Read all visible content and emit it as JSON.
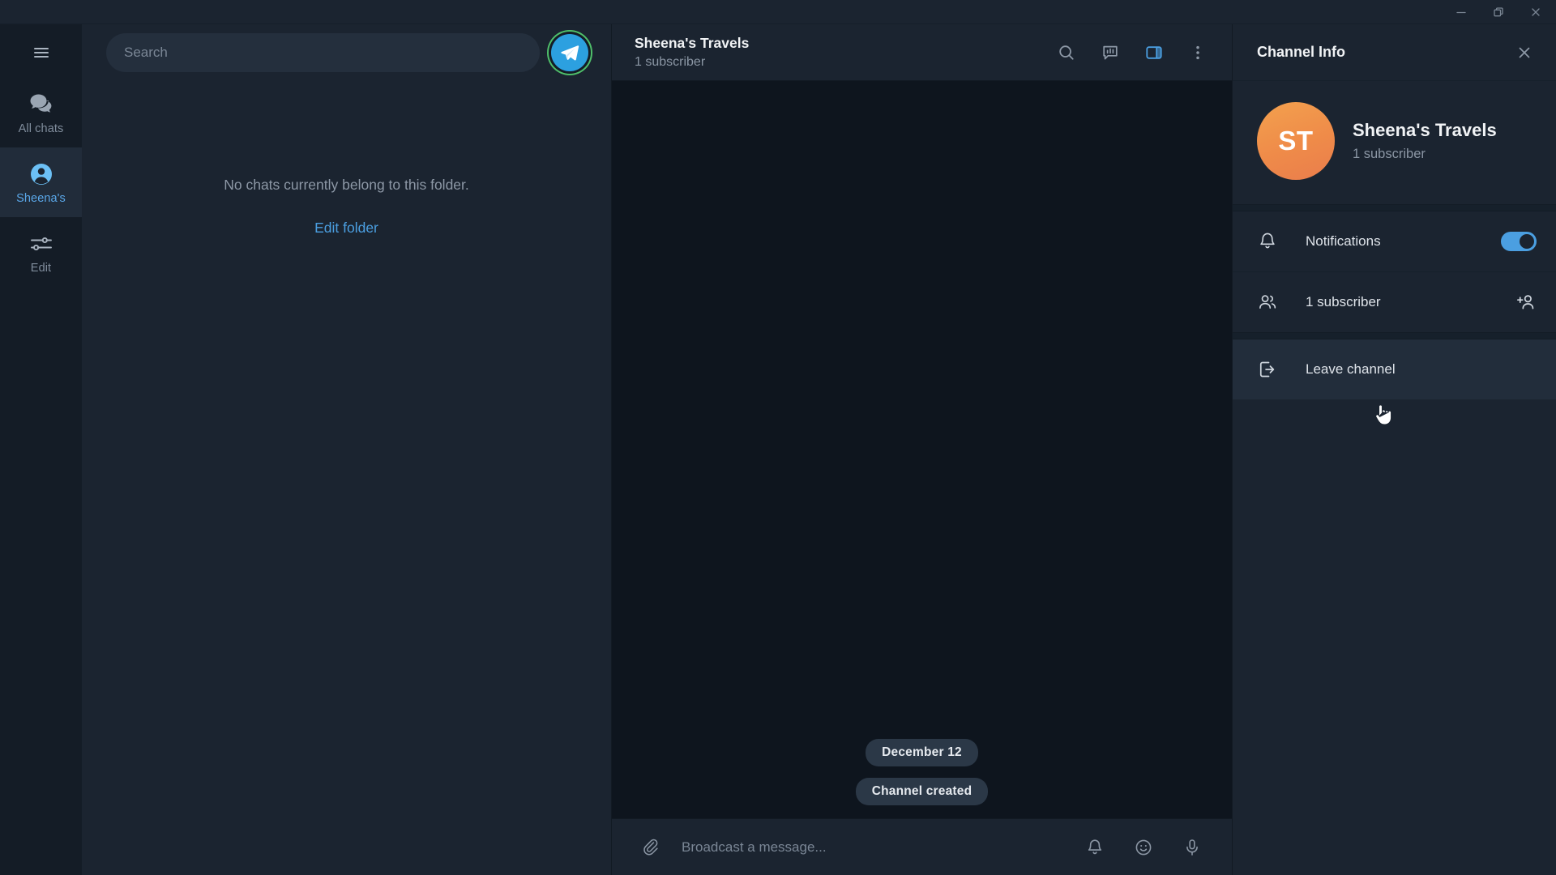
{
  "window": {
    "minimize_label": "Minimize",
    "restore_label": "Restore",
    "close_label": "Close"
  },
  "rail": {
    "menu_icon": "hamburger-menu-icon",
    "items": [
      {
        "label": "All chats",
        "icon": "chats-icon",
        "active": false
      },
      {
        "label": "Sheena's",
        "icon": "person-icon",
        "active": true
      },
      {
        "label": "Edit",
        "icon": "sliders-icon",
        "active": false
      }
    ]
  },
  "chatlist": {
    "search": {
      "placeholder": "Search",
      "icon": "search-icon"
    },
    "telegram_button_icon": "telegram-plane-icon",
    "empty_text": "No chats currently belong to this folder.",
    "edit_folder_label": "Edit folder"
  },
  "conversation": {
    "title": "Sheena's Travels",
    "subtitle": "1 subscriber",
    "actions": [
      {
        "name": "search-icon",
        "label": "Search",
        "accent": false
      },
      {
        "name": "statistics-icon",
        "label": "Statistics",
        "accent": false
      },
      {
        "name": "toggle-info-panel-icon",
        "label": "Channel info",
        "accent": true
      },
      {
        "name": "more-options-icon",
        "label": "More",
        "accent": false
      }
    ],
    "service_messages": [
      {
        "text": "December 12",
        "type": "date"
      },
      {
        "text": "Channel created",
        "type": "service"
      }
    ],
    "composer": {
      "attach_icon": "paperclip-icon",
      "placeholder": "Broadcast a message...",
      "right_icons": [
        {
          "name": "bell-icon",
          "label": "Silent broadcast"
        },
        {
          "name": "emoji-icon",
          "label": "Emoji"
        },
        {
          "name": "microphone-icon",
          "label": "Voice message"
        }
      ]
    }
  },
  "info_panel": {
    "title": "Channel Info",
    "close_icon": "close-icon",
    "avatar_initials": "ST",
    "avatar_color": "#f0914d",
    "name": "Sheena's Travels",
    "subtitle": "1 subscriber",
    "rows": [
      {
        "id": "notifications",
        "icon": "bell-icon",
        "label": "Notifications",
        "control": "toggle",
        "toggle_on": true,
        "hover": false
      },
      {
        "id": "subscribers",
        "icon": "people-icon",
        "label": "1 subscriber",
        "control": "add-member-icon",
        "hover": false
      },
      {
        "id": "leave-channel",
        "icon": "leave-icon",
        "label": "Leave channel",
        "control": "none",
        "hover": true
      }
    ]
  },
  "colors": {
    "accent": "#4b9fe1",
    "panel_bg": "#1b2430",
    "chat_bg": "#0e151e",
    "rail_bg": "#141c26",
    "avatar_orange": "#f0914d",
    "online_ring": "#4fbf6a"
  }
}
